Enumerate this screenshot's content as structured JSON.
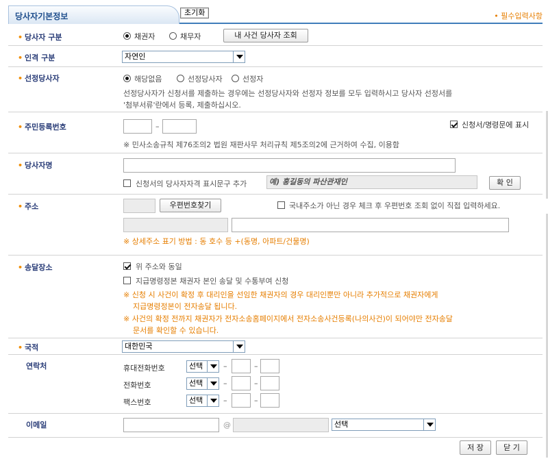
{
  "header": {
    "tab_title": "당사자기본정보",
    "reset_label": "초기화",
    "required_note": "• 필수입력사항"
  },
  "party_type": {
    "label": "당사자 구분",
    "option_creditor": "채권자",
    "option_debtor": "채무자",
    "lookup_button": "내 사건 당사자 조회"
  },
  "person_type": {
    "label": "인격 구분",
    "selected": "자연인"
  },
  "appointed_party": {
    "label": "선정당사자",
    "option_none": "해당없음",
    "option_appointed": "선정당사자",
    "option_appointer": "선정자",
    "help_line1": "선정당사자가 신청서를 제출하는 경우에는 선정당사자와 선정자 정보를 모두 입력하시고 당사자 선정서를",
    "help_line2": "'첨부서류'란에서 등록, 제출하십시오."
  },
  "resident_number": {
    "label": "주민등록번호",
    "show_label": "신청서/명령문에 표시",
    "notice": "※ 민사소송규칙 제76조의2 법원 재판사무 처리규칙 제5조의2에 근거하여 수집, 이용함"
  },
  "party_name": {
    "label": "당사자명",
    "qualifier_label": "신청서의 당사자자격 표시문구 추가",
    "qualifier_example": "예) 홍길동의 파산관재인",
    "confirm_button": "확 인"
  },
  "address": {
    "label": "주소",
    "postcode_button": "우편번호찾기",
    "overseas_label": "국내주소가 아닌 경우 체크 후 우편번호 조회 없이 직접 입력하세요.",
    "format_note": "※ 상세주소 표기 방법 : 동 호수 등 +(동명, 아파트/건물명)"
  },
  "delivery": {
    "label": "송달장소",
    "same_as_address": "위 주소와 동일",
    "request_label": "지급명령정본 채권자 본인 송달 및 수통부여 신청",
    "note1_line1": "※ 신청 시 사건이 확정 후 대리인을 선임한 채권자의 경우 대리인뿐만 아니라 추가적으로 채권자에게",
    "note1_line2": "지급명령정본이 전자송달 됩니다.",
    "note2_line1": "※ 사건의 확정 전까지 채권자가 전자소송홈페이지에서 전자소송사건등록(나의사건)이 되어야만 전자송달",
    "note2_line2": "문서를 확인할 수 있습니다."
  },
  "nationality": {
    "label": "국적",
    "selected": "대한민국"
  },
  "contact": {
    "label": "연락처",
    "mobile_label": "휴대전화번호",
    "phone_label": "전화번호",
    "fax_label": "팩스번호",
    "select_default": "선택"
  },
  "email": {
    "label": "이메일",
    "at_sign": "@",
    "domain_select": "선택"
  },
  "footer": {
    "save_button": "저 장",
    "close_button": "닫 기"
  }
}
